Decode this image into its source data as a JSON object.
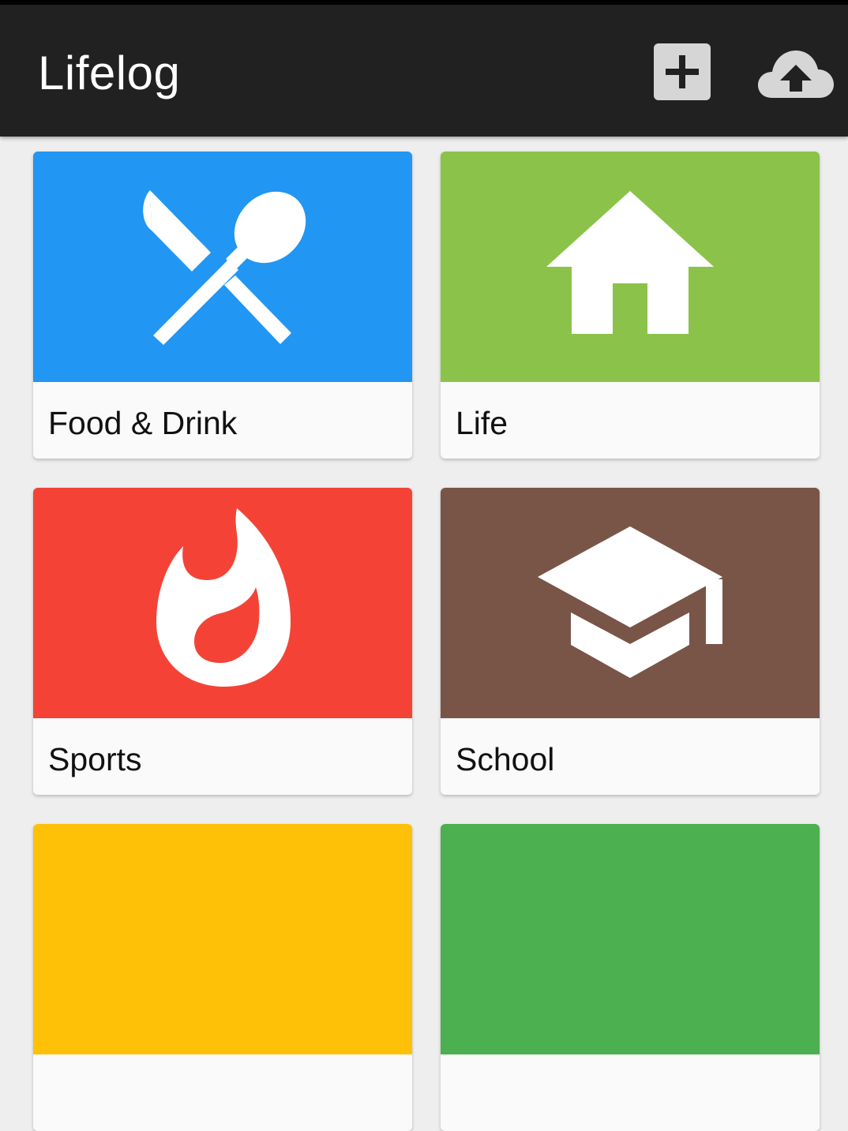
{
  "app": {
    "title": "Lifelog"
  },
  "toolbar": {
    "add_icon": "plus-icon",
    "upload_icon": "cloud-upload-icon"
  },
  "categories": [
    {
      "label": "Food & Drink",
      "color": "#2196F3",
      "icon": "restaurant-icon"
    },
    {
      "label": "Life",
      "color": "#8BC34A",
      "icon": "home-icon"
    },
    {
      "label": "Sports",
      "color": "#F44336",
      "icon": "flame-icon"
    },
    {
      "label": "School",
      "color": "#795548",
      "icon": "graduation-cap-icon"
    },
    {
      "label": "",
      "color": "#FFC107",
      "icon": ""
    },
    {
      "label": "",
      "color": "#4CAF50",
      "icon": ""
    }
  ]
}
